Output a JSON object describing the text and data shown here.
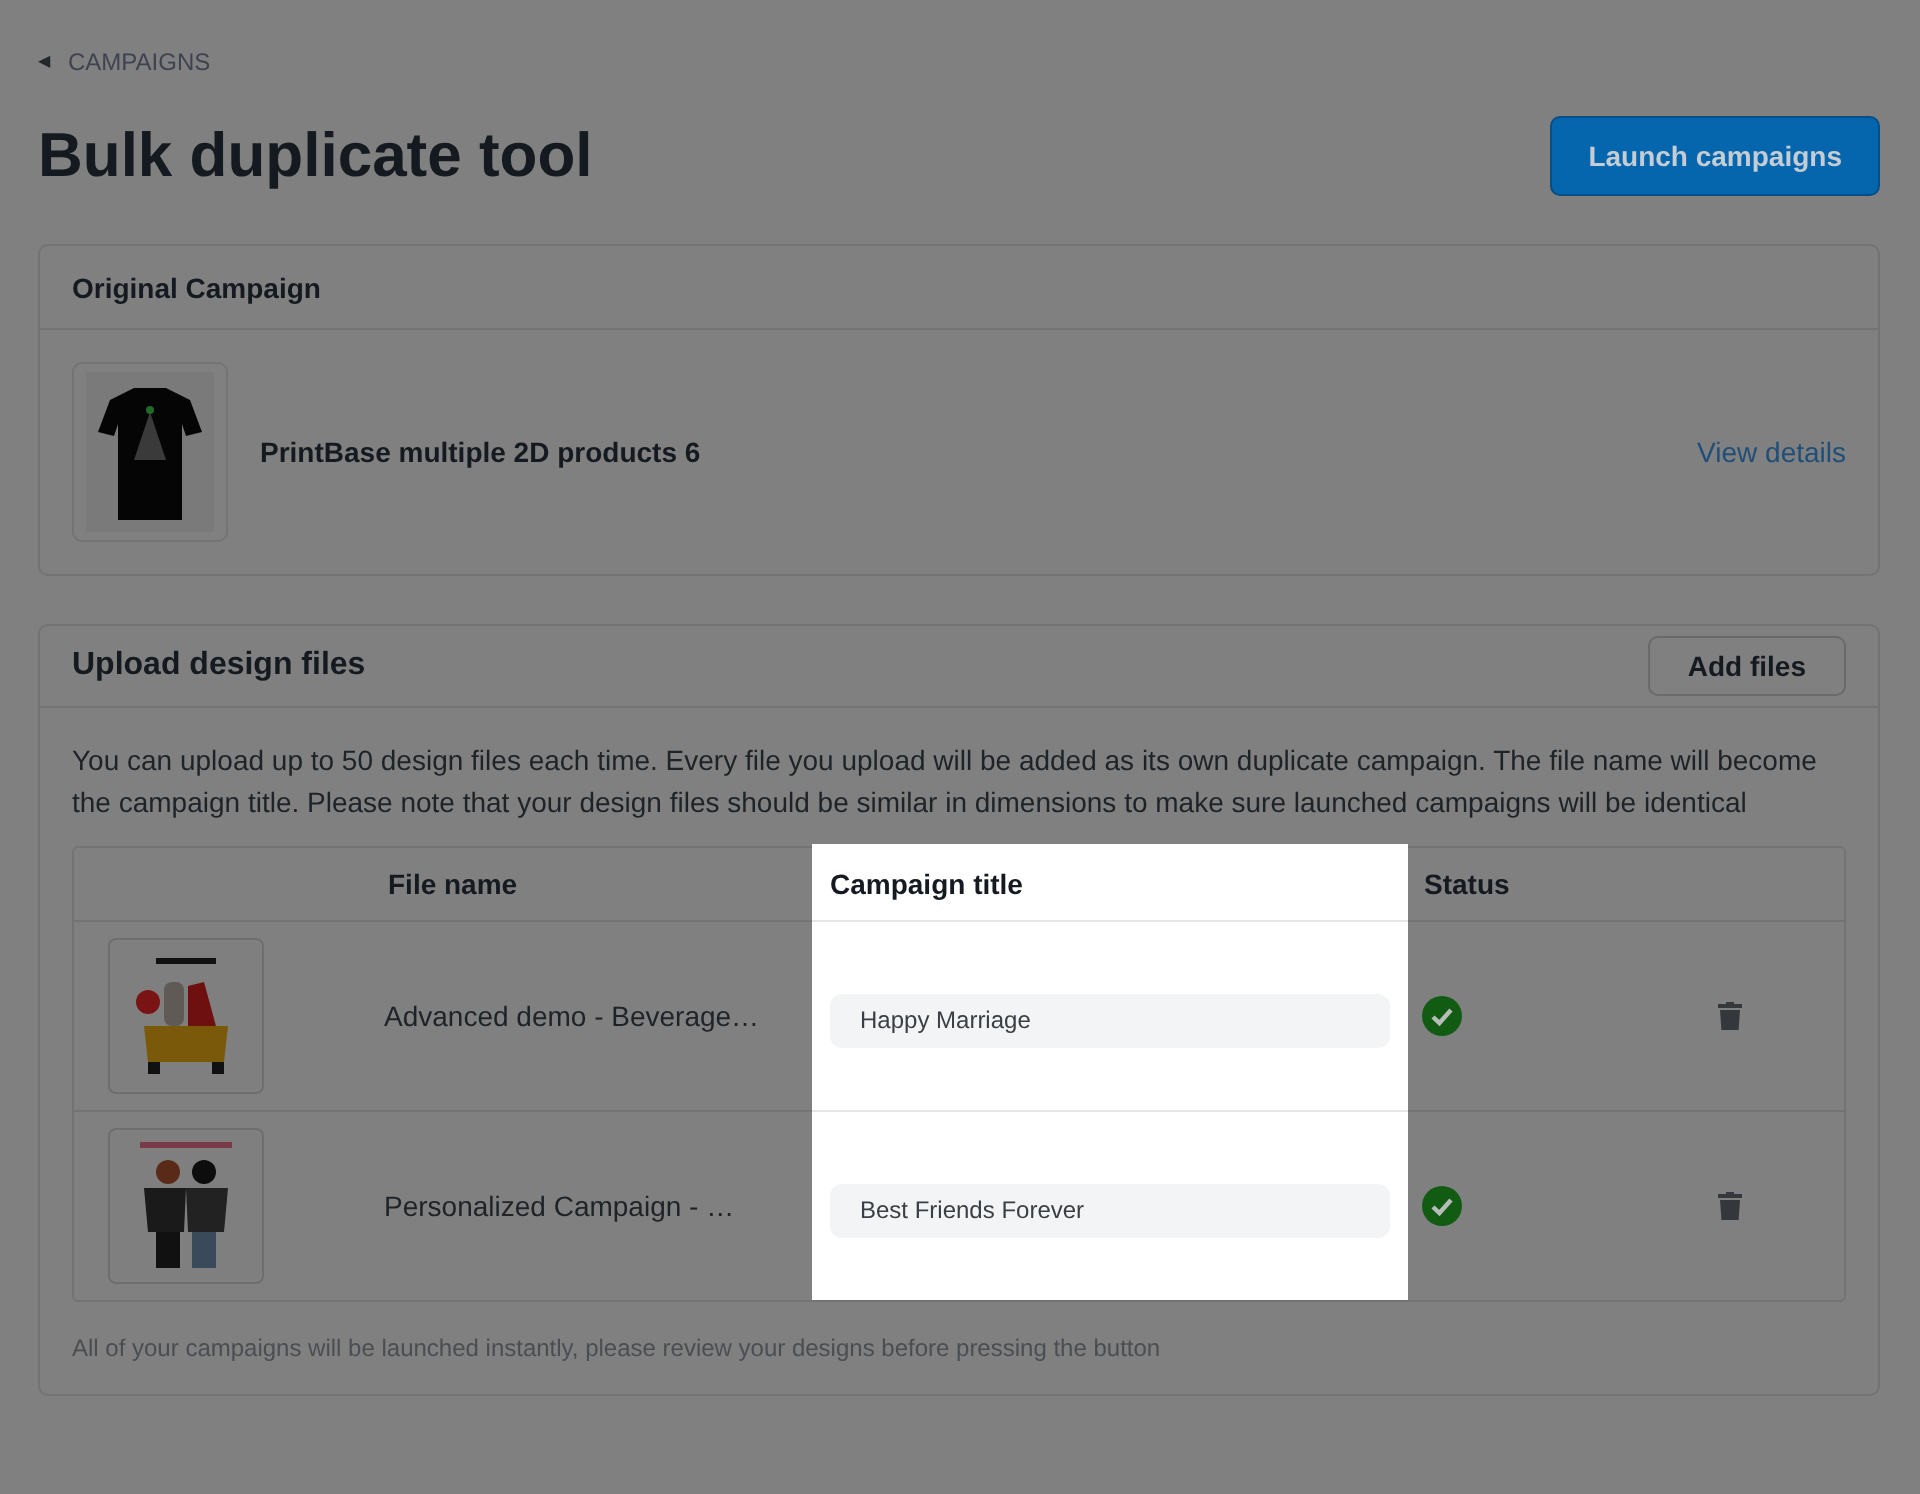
{
  "breadcrumb": {
    "arrow": "◀",
    "label": "CAMPAIGNS"
  },
  "page_title": "Bulk duplicate tool",
  "primary_button": "Launch campaigns",
  "original_campaign": {
    "heading": "Original Campaign",
    "name": "PrintBase multiple 2D products 6",
    "link": "View details"
  },
  "upload": {
    "heading": "Upload design files",
    "button": "Add files",
    "description": "You can upload up to 50 design files each time. Every file you upload will be added as its own duplicate campaign. The file name will become the campaign title. Please note that your design files should be similar in dimensions to make sure launched campaigns will be identical",
    "table": {
      "columns": [
        {
          "highlighted": false
        },
        {
          "label": "File name",
          "highlighted": false
        },
        {
          "label": "Campaign title",
          "highlighted": true
        },
        {
          "label": "Status",
          "highlighted": false
        },
        {
          "highlighted": false
        }
      ],
      "rows": [
        {
          "file_name": "Advanced demo - Beverage…",
          "campaign_title": "Happy Marriage",
          "valid": true
        },
        {
          "file_name": "Personalized Campaign - …",
          "campaign_title": "Best Friends Forever",
          "valid": true
        }
      ]
    },
    "note": "All of your campaigns will be launched instantly, please review your designs before pressing the button"
  }
}
